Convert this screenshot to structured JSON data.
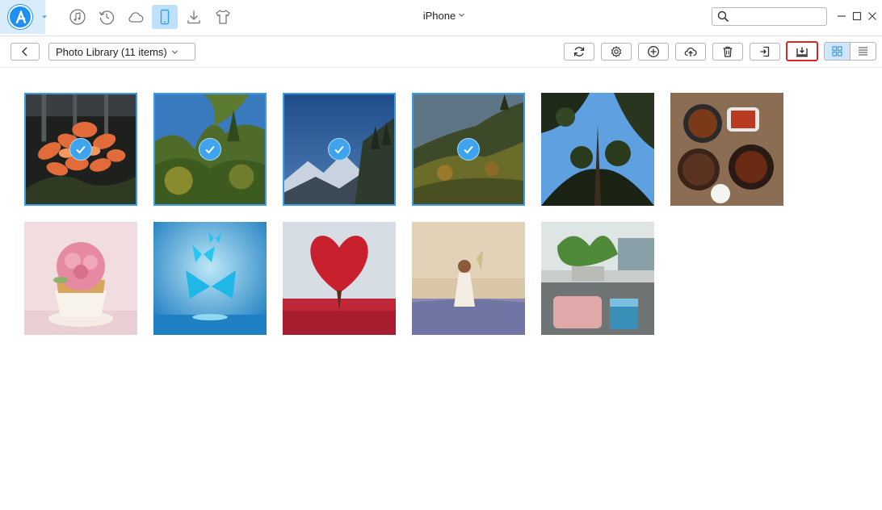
{
  "window": {
    "title": "iPhone"
  },
  "titlebar": {
    "nav_icons": [
      {
        "name": "music-icon",
        "active": false
      },
      {
        "name": "history-icon",
        "active": false
      },
      {
        "name": "cloud-icon",
        "active": false
      },
      {
        "name": "phone-icon",
        "active": true
      },
      {
        "name": "download-icon",
        "active": false
      },
      {
        "name": "shirt-icon",
        "active": false
      }
    ],
    "search": {
      "value": "",
      "placeholder": ""
    }
  },
  "toolbar": {
    "library_label": "Photo Library (11 items)",
    "tools": [
      "refresh-icon",
      "settings-icon",
      "add-icon",
      "upload-cloud-icon",
      "delete-icon",
      "export-to-device-icon",
      "download-to-computer-icon"
    ],
    "highlighted_tool": "download-to-computer-icon",
    "view_mode": "grid"
  },
  "photos": [
    {
      "name": "photo-orange-flowers",
      "selected": true
    },
    {
      "name": "photo-pine-trees-blue-sky",
      "selected": true
    },
    {
      "name": "photo-snowy-mountains",
      "selected": true
    },
    {
      "name": "photo-forest-hillside",
      "selected": true
    },
    {
      "name": "photo-trees-looking-up",
      "selected": false
    },
    {
      "name": "photo-chinese-food-table",
      "selected": false
    },
    {
      "name": "photo-pink-rose-cupcake",
      "selected": false
    },
    {
      "name": "photo-blue-butterflies",
      "selected": false
    },
    {
      "name": "photo-red-heart-tree",
      "selected": false
    },
    {
      "name": "photo-girl-in-field",
      "selected": false
    },
    {
      "name": "photo-office-desk-plant",
      "selected": false
    }
  ],
  "colors": {
    "accent": "#3a9de6",
    "highlight": "#e32424",
    "active_nav": "#bfe0fb"
  }
}
